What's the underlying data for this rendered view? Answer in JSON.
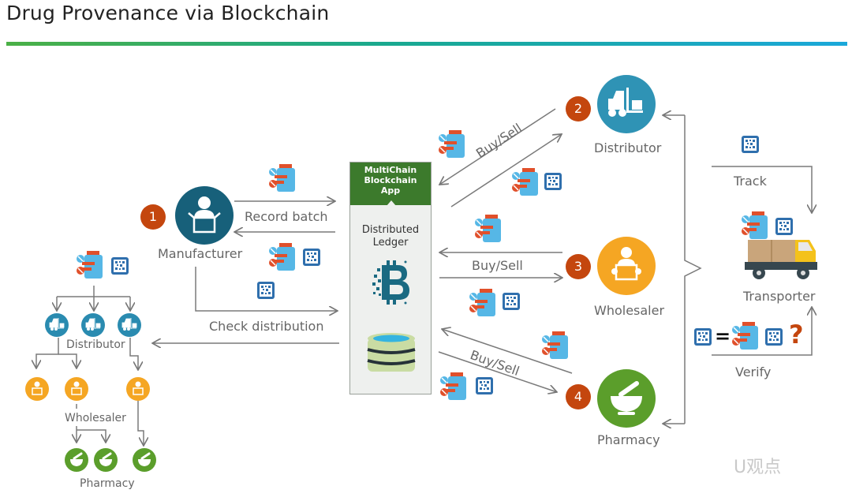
{
  "title": "Drug Provenance via Blockchain",
  "colors": {
    "manufacturer": "#17607a",
    "distributor": "#2f93b5",
    "wholesaler": "#f5a623",
    "pharmacy": "#5b9e2b",
    "step_badge": "#c4460e",
    "panel_header": "#3c7a2c",
    "ledger_icon": "#1a6a82",
    "rule_start": "#4bb046",
    "rule_end": "#1aa8da"
  },
  "blockchain_app": {
    "header_lines": [
      "MultiChain",
      "Blockchain",
      "App"
    ],
    "ledger_lines": [
      "Distributed",
      "Ledger"
    ],
    "icons": [
      "bitcoin-pixel-icon",
      "database-icon"
    ]
  },
  "actors": {
    "manufacturer": {
      "step": "1",
      "label": "Manufacturer",
      "icon": "person-box-icon"
    },
    "distributor": {
      "step": "2",
      "label": "Distributor",
      "icon": "forklift-icon"
    },
    "wholesaler": {
      "step": "3",
      "label": "Wholesaler",
      "icon": "person-box-icon"
    },
    "pharmacy": {
      "step": "4",
      "label": "Pharmacy",
      "icon": "mortar-pestle-icon"
    },
    "transporter": {
      "label": "Transporter",
      "icon": "truck-icon"
    }
  },
  "flows": {
    "record_batch": "Record  batch",
    "check_distribution": "Check distribution",
    "buy_sell_distributor": "Buy/Sell",
    "buy_sell_wholesaler": "Buy/Sell",
    "buy_sell_pharmacy": "Buy/Sell",
    "track": "Track",
    "verify": "Verify"
  },
  "verify_equation": {
    "equals": "=",
    "question": "?"
  },
  "tree": {
    "distributor_label": "Distributor",
    "wholesaler_label": "Wholesaler",
    "pharmacy_label": "Pharmacy"
  },
  "watermark": "U观点"
}
